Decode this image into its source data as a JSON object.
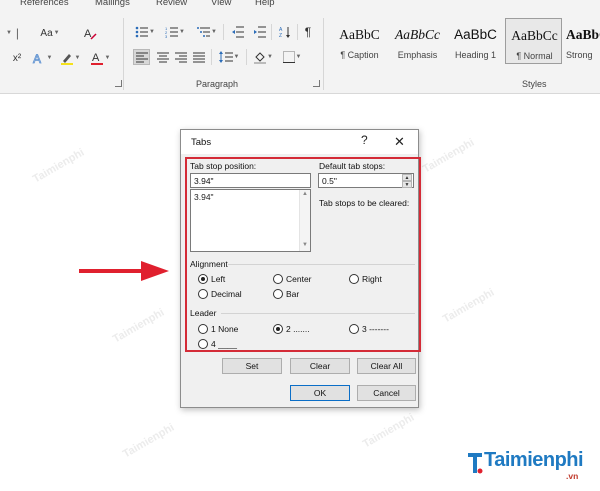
{
  "ribbon": {
    "tabs": [
      "References",
      "Mailings",
      "Review",
      "View",
      "Help"
    ],
    "groups": {
      "font_label": "",
      "paragraph_label": "Paragraph",
      "styles_label": "Styles"
    },
    "font_buttons": {
      "aa_label": "Aa",
      "superscript_label": "x²"
    },
    "styles": [
      {
        "sample": "AaBbC",
        "name": "¶ Caption"
      },
      {
        "sample": "AaBbCc",
        "name": "Emphasis"
      },
      {
        "sample": "AaBbC",
        "name": "Heading 1"
      },
      {
        "sample": "AaBbCc",
        "name": "¶ Normal"
      },
      {
        "sample": "AaBbC",
        "name": "Strong"
      }
    ]
  },
  "dialog": {
    "title": "Tabs",
    "help_glyph": "?",
    "close_glyph": "✕",
    "tab_stop_position_label": "Tab stop position:",
    "tab_stop_position_value": "3.94\"",
    "tab_stop_list": [
      "3.94\""
    ],
    "default_tab_stops_label": "Default tab stops:",
    "default_tab_stops_value": "0.5\"",
    "to_be_cleared_label": "Tab stops to be cleared:",
    "alignment_label": "Alignment",
    "alignment_options": [
      {
        "label": "Left",
        "checked": true
      },
      {
        "label": "Center",
        "checked": false
      },
      {
        "label": "Right",
        "checked": false
      },
      {
        "label": "Decimal",
        "checked": false
      },
      {
        "label": "Bar",
        "checked": false
      }
    ],
    "leader_label": "Leader",
    "leader_options": [
      {
        "label": "1 None",
        "checked": false
      },
      {
        "label": "2 .......",
        "checked": true
      },
      {
        "label": "3 -------",
        "checked": false
      },
      {
        "label": "4 ____",
        "checked": false
      }
    ],
    "buttons": {
      "set": "Set",
      "clear": "Clear",
      "clear_all": "Clear All",
      "ok": "OK",
      "cancel": "Cancel"
    }
  },
  "logo": {
    "text": "Taimienphi",
    "suffix": ".vn"
  },
  "watermark": "Taimienphi",
  "colors": {
    "highlight": "#d42b37",
    "arrow": "#e0202e",
    "logo_blue": "#1f7ac2"
  }
}
